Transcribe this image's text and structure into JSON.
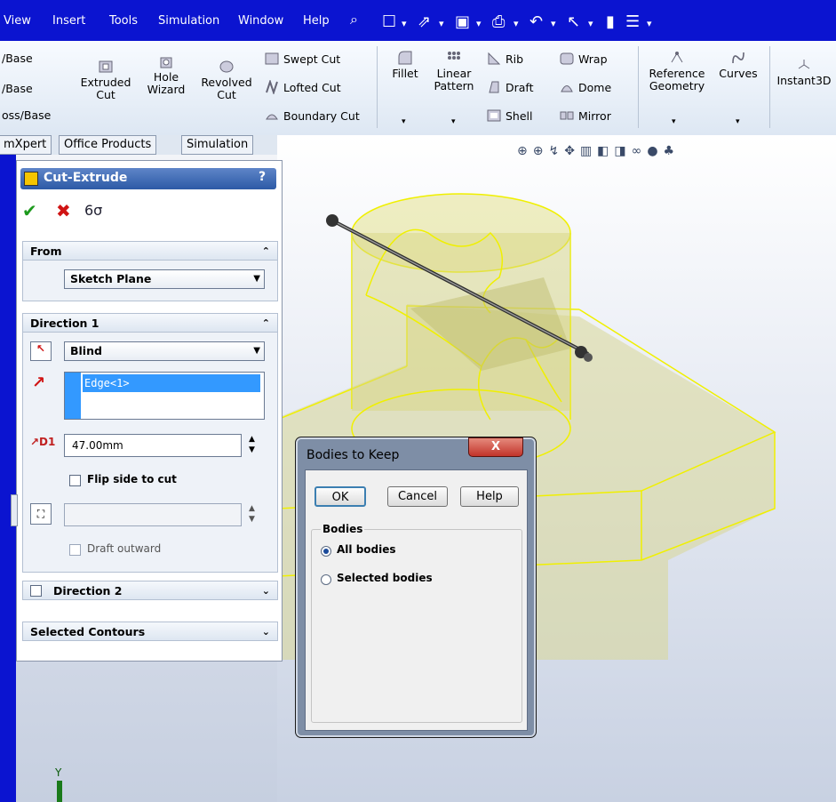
{
  "menu": [
    "View",
    "Insert",
    "Tools",
    "Simulation",
    "Window",
    "Help"
  ],
  "ribbon": {
    "base_items": [
      "/Base",
      "/Base",
      "oss/Base"
    ],
    "extruded_cut": "Extruded\nCut",
    "hole_wizard": "Hole\nWizard",
    "revolved_cut": "Revolved\nCut",
    "swept_cut": "Swept Cut",
    "lofted_cut": "Lofted Cut",
    "boundary_cut": "Boundary Cut",
    "fillet": "Fillet",
    "linear_pattern": "Linear\nPattern",
    "rib": "Rib",
    "draft": "Draft",
    "shell": "Shell",
    "wrap": "Wrap",
    "dome": "Dome",
    "mirror": "Mirror",
    "reference_geometry": "Reference\nGeometry",
    "curves": "Curves",
    "instant3d": "Instant3D"
  },
  "tabs": [
    "mXpert",
    "Office Products",
    "Simulation"
  ],
  "pm": {
    "title": "Cut-Extrude",
    "help": "?",
    "from_label": "From",
    "from_value": "Sketch Plane",
    "dir1_label": "Direction 1",
    "dir1_type": "Blind",
    "edge_value": "Edge<1>",
    "depth": "47.00mm",
    "flip_label": "Flip side to cut",
    "draft_outward": "Draft outward",
    "dir2_label": "Direction 2",
    "contours_label": "Selected Contours"
  },
  "dialog": {
    "title": "Bodies to Keep",
    "close": "X",
    "ok": "OK",
    "cancel": "Cancel",
    "help": "Help",
    "group": "Bodies",
    "opt_all": "All bodies",
    "opt_selected": "Selected bodies"
  },
  "colors": {
    "desktop": "#0b14d0",
    "selection": "#3399ff",
    "model": "#e0e000"
  }
}
